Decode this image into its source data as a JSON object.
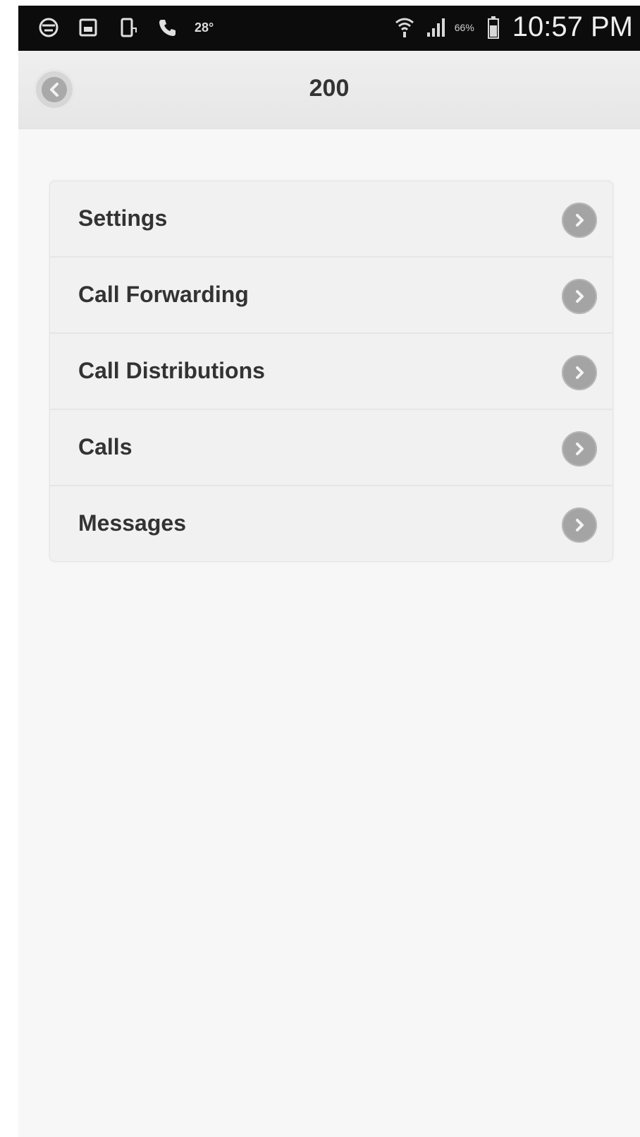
{
  "status_bar": {
    "temperature": "28°",
    "battery_percent": "66%",
    "time": "10:57 PM"
  },
  "header": {
    "title": "200"
  },
  "menu": {
    "items": [
      {
        "label": "Settings"
      },
      {
        "label": "Call Forwarding"
      },
      {
        "label": "Call Distributions"
      },
      {
        "label": "Calls"
      },
      {
        "label": "Messages"
      }
    ]
  },
  "icons": {
    "status_left": [
      "browser-icon",
      "gallery-icon",
      "screenshot-icon",
      "phone-icon",
      "weather-icon"
    ],
    "status_right": [
      "wifi-icon",
      "signal-icon",
      "battery-icon"
    ],
    "back": "back-icon",
    "row": "chevron-right-icon"
  },
  "colors": {
    "status_bar": "#0c0c0c",
    "header": "#e8e8e8",
    "background": "#f7f7f7",
    "list": "#f1f1f1",
    "text": "#333333",
    "chevron": "#a4a4a4"
  }
}
